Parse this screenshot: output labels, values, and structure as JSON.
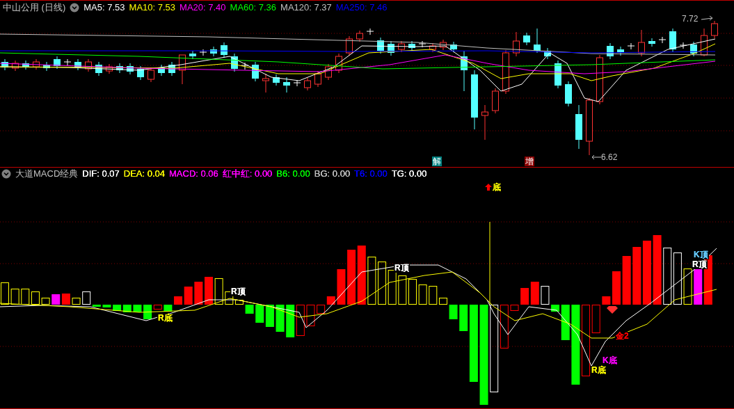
{
  "chart_window": {
    "title": "中山公用 (日线)",
    "indicators": [
      {
        "label": "MA5: 7.53",
        "color": "#ffffff"
      },
      {
        "label": "MA10: 7.53",
        "color": "#ffff00"
      },
      {
        "label": "MA20: 7.40",
        "color": "#ff00ff"
      },
      {
        "label": "MA60: 7.36",
        "color": "#00ff00"
      },
      {
        "label": "MA120: 7.37",
        "color": "#c0c0c0"
      },
      {
        "label": "MA250: 7.46",
        "color": "#0000ff"
      }
    ]
  },
  "price_labels": [
    {
      "text": "7.72"
    },
    {
      "text": "6.62"
    }
  ],
  "signal_badges": [
    {
      "text": "解",
      "color": "#008080"
    },
    {
      "text": "增",
      "color": "#8b0000"
    }
  ],
  "macd_panel": {
    "title": "大道MACD经典",
    "indicators": [
      {
        "label": "DIF: 0.07",
        "color": "#ffffff"
      },
      {
        "label": "DEA: 0.04",
        "color": "#ffff00"
      },
      {
        "label": "MACD: 0.06",
        "color": "#ff00ff"
      },
      {
        "label": "红中红: 0.00",
        "color": "#ff00ff"
      },
      {
        "label": "B6: 0.00",
        "color": "#00ff00"
      },
      {
        "label": "BG: 0.00",
        "color": "#c0c0c0"
      },
      {
        "label": "T6: 0.00",
        "color": "#0000ff"
      },
      {
        "label": "TG: 0.00",
        "color": "#ffffff"
      }
    ]
  },
  "annotations": [
    {
      "text": "底",
      "color": "#ffff00"
    },
    {
      "text": "R底",
      "color": "#ffff00"
    },
    {
      "text": "R顶",
      "color": "#ffffff"
    },
    {
      "text": "R顶",
      "color": "#ffffff"
    },
    {
      "text": "金2",
      "color": "#ff0000"
    },
    {
      "text": "K底",
      "color": "#ff00ff"
    },
    {
      "text": "R底",
      "color": "#ffff00"
    },
    {
      "text": "K顶",
      "color": "#66ccff"
    },
    {
      "text": "R顶",
      "color": "#ffffff"
    }
  ]
}
